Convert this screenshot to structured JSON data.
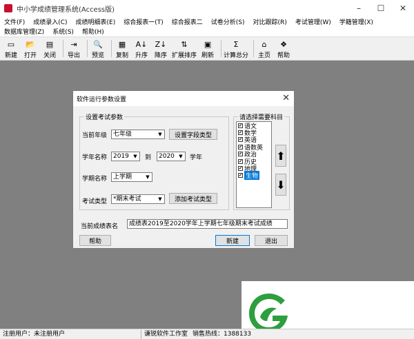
{
  "window": {
    "title": "中小学成绩管理系统(Access版)",
    "controls": {
      "minimize": "–",
      "maximize": "☐",
      "close": "✕"
    }
  },
  "menu": {
    "row1": [
      "文件(F)",
      "成绩录入(C)",
      "成绩明细表(E)",
      "综合报表一(T)",
      "综合报表二",
      "试卷分析(S)",
      "对比跟踪(R)",
      "考试管理(W)",
      "学籍管理(X)"
    ],
    "row2": [
      "数据库管理(Z)",
      "系统(S)",
      "帮助(H)"
    ]
  },
  "toolbar": {
    "items": [
      {
        "label": "新建",
        "icon": "new-file-icon",
        "glyph": "▭"
      },
      {
        "label": "打开",
        "icon": "open-folder-icon",
        "glyph": "📂"
      },
      {
        "label": "关闭",
        "icon": "close-file-icon",
        "glyph": "▤"
      },
      {
        "label": "导出",
        "icon": "export-icon",
        "glyph": "⇥"
      },
      {
        "label": "预览",
        "icon": "preview-icon",
        "glyph": "🔍"
      },
      {
        "label": "复制",
        "icon": "copy-icon",
        "glyph": "▦"
      },
      {
        "label": "升序",
        "icon": "sort-asc-icon",
        "glyph": "A↓"
      },
      {
        "label": "降序",
        "icon": "sort-desc-icon",
        "glyph": "Z↓"
      },
      {
        "label": "扩展排序",
        "icon": "extended-sort-icon",
        "glyph": "⇅"
      },
      {
        "label": "刷新",
        "icon": "refresh-icon",
        "glyph": "▣"
      },
      {
        "label": "计算总分",
        "icon": "sum-icon",
        "glyph": "Σ"
      },
      {
        "label": "主页",
        "icon": "home-icon",
        "glyph": "⌂"
      },
      {
        "label": "帮助",
        "icon": "help-icon",
        "glyph": "❖"
      }
    ]
  },
  "dialog": {
    "title": "软件运行参数设置",
    "close": "✕",
    "exam_group": {
      "label": "设置考试参数",
      "grade_label": "当前年级",
      "grade_value": "七年级",
      "set_subjects_button": "设置字段类型",
      "year_label": "学年名称",
      "year_from": "2019",
      "year_to_label": "到",
      "year_to": "2020",
      "year_suffix": "学年",
      "term_label": "学期名称",
      "term_value": "上学期",
      "exam_type_label": "考试类型",
      "exam_type_value": "*期末考试",
      "add_exam_type_button": "添加考试类型"
    },
    "subject_group": {
      "label": "请选择需要科目",
      "subjects": [
        {
          "name": "语文",
          "checked": true
        },
        {
          "name": "数学",
          "checked": true
        },
        {
          "name": "英语",
          "checked": true
        },
        {
          "name": "语数英",
          "checked": true
        },
        {
          "name": "政治",
          "checked": true
        },
        {
          "name": "历史",
          "checked": true
        },
        {
          "name": "地理",
          "checked": true
        },
        {
          "name": "生物",
          "checked": true,
          "selected": true
        }
      ],
      "up_arrow": "⬆",
      "down_arrow": "⬇"
    },
    "table_label": "当前成绩表名",
    "table_value": "成绩表2019至2020学年上学期七年级期末考试成绩",
    "help_button": "帮助",
    "new_button": "新建",
    "exit_button": "退出"
  },
  "status": {
    "user": "注册用户：未注册用户",
    "company": "谦锐软件工作室",
    "hotline": "销售热线：1388133"
  },
  "colors": {
    "logo_green": "#2e9e3e",
    "selection": "#0078d7"
  }
}
